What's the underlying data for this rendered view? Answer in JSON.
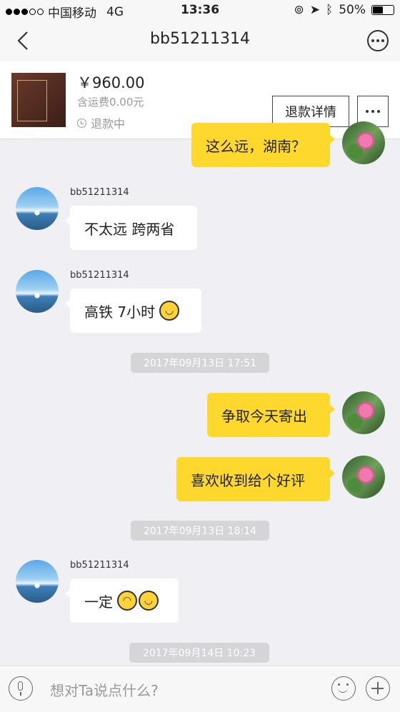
{
  "status_bar": {
    "carrier": "中国移动",
    "network": "4G",
    "time": "13:36",
    "battery": "50%"
  },
  "nav": {
    "title": "bb51211314"
  },
  "order": {
    "price": "￥960.00",
    "shipping": "含运费0.00元",
    "status": "退款中",
    "refund_button": "退款详情"
  },
  "messages": [
    {
      "direction": "out",
      "text": "这么远，湖南？"
    },
    {
      "direction": "in",
      "sender": "bb51211314",
      "text": "不太远 跨两省"
    },
    {
      "direction": "in",
      "sender": "bb51211314",
      "text": "高铁 7小时"
    },
    {
      "type": "timestamp",
      "text": "2017年09月13日 17:51"
    },
    {
      "direction": "out",
      "text": "争取今天寄出"
    },
    {
      "direction": "out",
      "text": "喜欢收到给个好评"
    },
    {
      "type": "timestamp",
      "text": "2017年09月13日 18:14"
    },
    {
      "direction": "in",
      "sender": "bb51211314",
      "text": "一定"
    },
    {
      "type": "timestamp",
      "text": "2017年09月14日 10:23"
    }
  ],
  "input": {
    "placeholder": "想对Ta说点什么?"
  },
  "colors": {
    "outgoing_bubble": "#ffd82e",
    "incoming_bubble": "#ffffff",
    "background": "#efeff4"
  }
}
